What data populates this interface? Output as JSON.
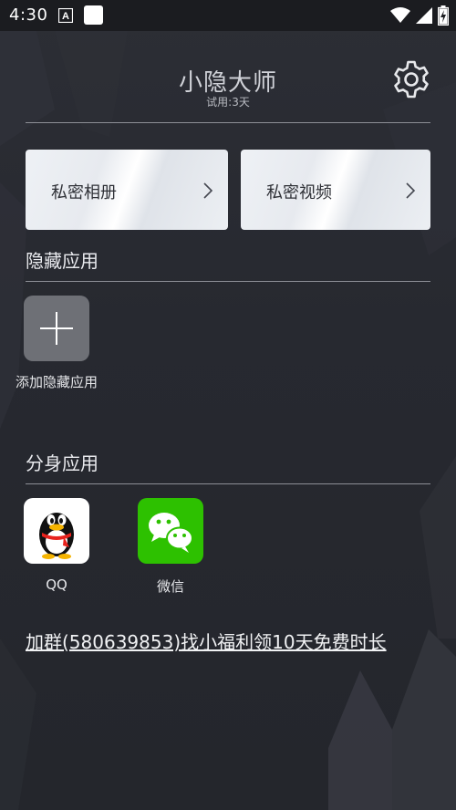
{
  "status_bar": {
    "time": "4:30",
    "icons": [
      "notification-a-icon",
      "notification-square-icon",
      "wifi-icon",
      "signal-icon",
      "battery-charging-icon"
    ]
  },
  "header": {
    "title": "小隐大师",
    "subtitle": "试用:3天",
    "settings_icon": "gear-icon"
  },
  "cards": [
    {
      "label": "私密相册",
      "icon": "chevron-right-icon"
    },
    {
      "label": "私密视频",
      "icon": "chevron-right-icon"
    }
  ],
  "hidden_apps": {
    "title": "隐藏应用",
    "add_label": "添加隐藏应用",
    "add_icon": "plus-icon"
  },
  "clone_apps": {
    "title": "分身应用",
    "apps": [
      {
        "label": "QQ",
        "icon": "qq-penguin-icon"
      },
      {
        "label": "微信",
        "icon": "wechat-icon"
      }
    ]
  },
  "promo": {
    "text": "加群(580639853)找小福利领10天免费时长"
  },
  "colors": {
    "background": "#2a2c33",
    "status_bar": "#1b1c20",
    "card": "#eceff3",
    "wechat_green": "#2dc100",
    "divider": "#8d8f96"
  }
}
